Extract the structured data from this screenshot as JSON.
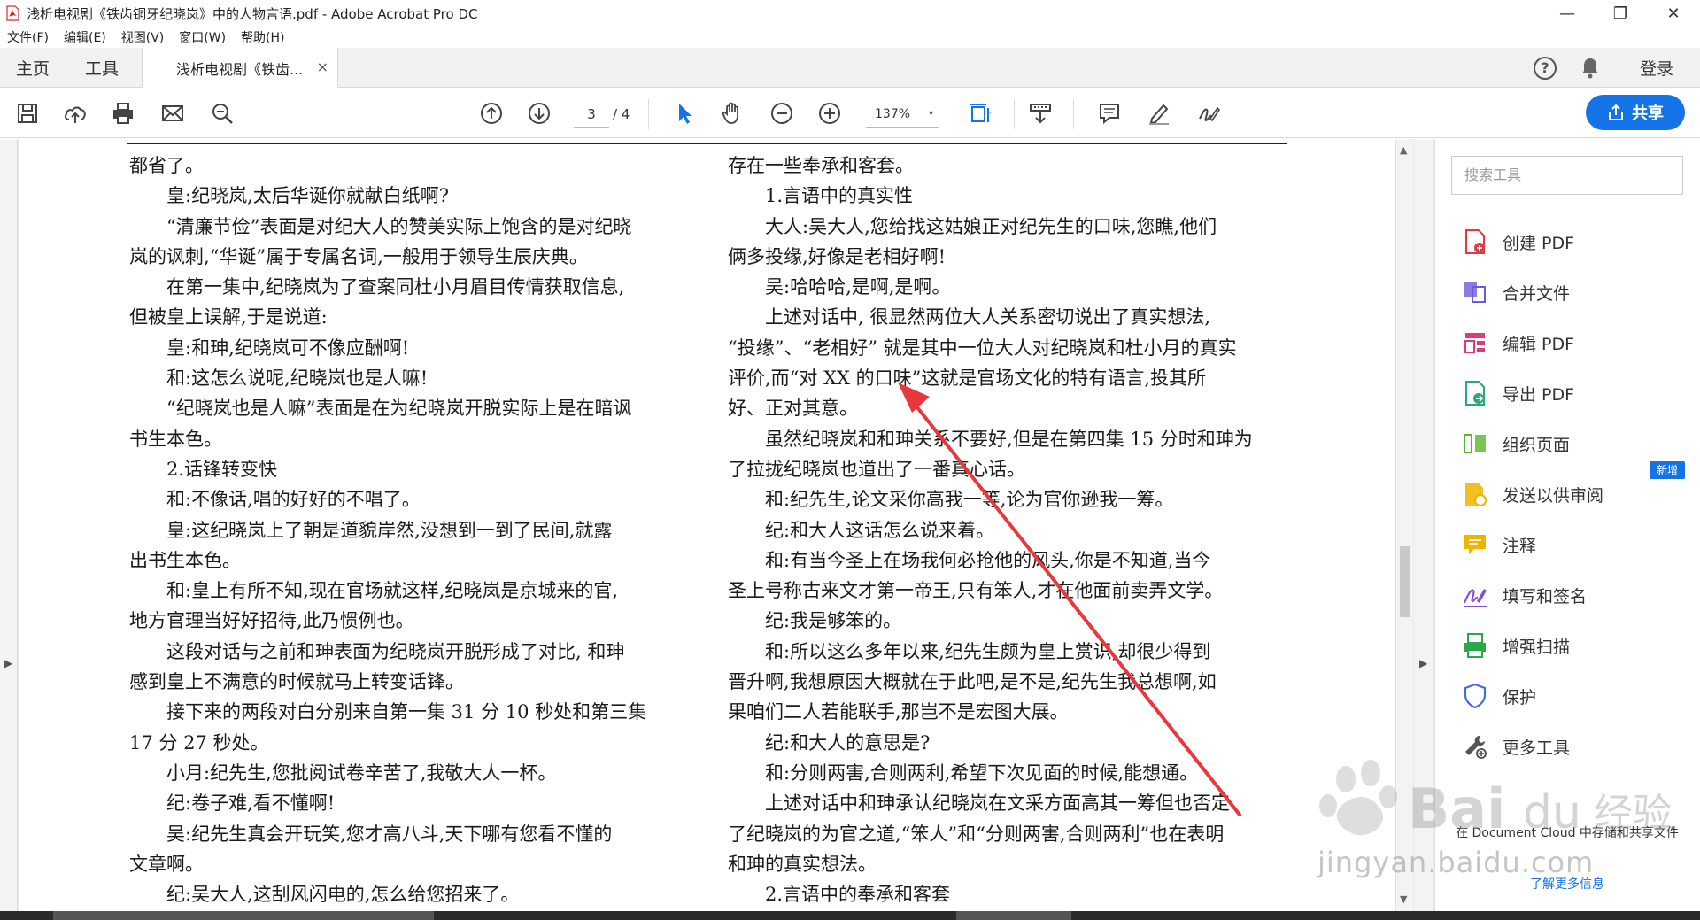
{
  "window": {
    "title": "浅析电视剧《铁齿铜牙纪晓岚》中的人物言语.pdf - Adobe Acrobat Pro DC",
    "minimize": "—",
    "maximize": "❐",
    "close": "✕"
  },
  "menu": [
    "文件(F)",
    "编辑(E)",
    "视图(V)",
    "窗口(W)",
    "帮助(H)"
  ],
  "tabs": {
    "home": "主页",
    "tools": "工具",
    "document": "浅析电视剧《铁齿...",
    "close": "×",
    "help": "?",
    "login": "登录"
  },
  "toolbar": {
    "page_current": "3",
    "page_total": "/ 4",
    "zoom": "137%",
    "zoom_caret": "▾",
    "share": "共享"
  },
  "document": {
    "left_column": [
      {
        "text": "都省了。",
        "indent": false
      },
      {
        "text": "皇:纪晓岚,太后华诞你就献白纸啊?",
        "indent": true
      },
      {
        "text": "“清廉节俭”表面是对纪大人的赞美实际上饱含的是对纪晓",
        "indent": true
      },
      {
        "text": "岚的讽刺,“华诞”属于专属名词,一般用于领导生辰庆典。",
        "indent": false
      },
      {
        "text": "在第一集中,纪晓岚为了查案同杜小月眉目传情获取信息,",
        "indent": true
      },
      {
        "text": "但被皇上误解,于是说道:",
        "indent": false
      },
      {
        "text": "皇:和珅,纪晓岚可不像应酬啊!",
        "indent": true
      },
      {
        "text": "和:这怎么说呢,纪晓岚也是人嘛!",
        "indent": true
      },
      {
        "text": "“纪晓岚也是人嘛”表面是在为纪晓岚开脱实际上是在暗讽",
        "indent": true
      },
      {
        "text": "书生本色。",
        "indent": false
      },
      {
        "text": "2.话锋转变快",
        "indent": true
      },
      {
        "text": "和:不像话,唱的好好的不唱了。",
        "indent": true
      },
      {
        "text": "皇:这纪晓岚上了朝是道貌岸然,没想到一到了民间,就露",
        "indent": true
      },
      {
        "text": "出书生本色。",
        "indent": false
      },
      {
        "text": "和:皇上有所不知,现在官场就这样,纪晓岚是京城来的官,",
        "indent": true
      },
      {
        "text": "地方官理当好好招待,此乃惯例也。",
        "indent": false
      },
      {
        "text": "这段对话与之前和珅表面为纪晓岚开脱形成了对比, 和珅",
        "indent": true
      },
      {
        "text": "感到皇上不满意的时候就马上转变话锋。",
        "indent": false
      },
      {
        "text": "接下来的两段对白分别来自第一集 31 分 10 秒处和第三集",
        "indent": true
      },
      {
        "text": "17 分 27 秒处。",
        "indent": false
      },
      {
        "text": "小月:纪先生,您批阅试卷辛苦了,我敬大人一杯。",
        "indent": true
      },
      {
        "text": "纪:卷子难,看不懂啊!",
        "indent": true
      },
      {
        "text": "吴:纪先生真会开玩笑,您才高八斗,天下哪有您看不懂的",
        "indent": true
      },
      {
        "text": "文章啊。",
        "indent": false
      },
      {
        "text": "纪:吴大人,这刮风闪电的,怎么给您招来了。",
        "indent": true
      }
    ],
    "right_column": [
      {
        "text": "存在一些奉承和客套。",
        "indent": false
      },
      {
        "text": "1.言语中的真实性",
        "indent": true
      },
      {
        "text": "大人:吴大人,您给找这姑娘正对纪先生的口味,您瞧,他们",
        "indent": true
      },
      {
        "text": "俩多投缘,好像是老相好啊!",
        "indent": false
      },
      {
        "text": "吴:哈哈哈,是啊,是啊。",
        "indent": true
      },
      {
        "text": "上述对话中, 很显然两位大人关系密切说出了真实想法,",
        "indent": true
      },
      {
        "text": "“投缘”、“老相好” 就是其中一位大人对纪晓岚和杜小月的真实",
        "indent": false
      },
      {
        "text": "评价,而“对 XX 的口味”这就是官场文化的特有语言,投其所",
        "indent": false
      },
      {
        "text": "好、正对其意。",
        "indent": false
      },
      {
        "text": "虽然纪晓岚和和珅关系不要好,但是在第四集 15 分时和珅为",
        "indent": true
      },
      {
        "text": "了拉拢纪晓岚也道出了一番真心话。",
        "indent": false
      },
      {
        "text": "和:纪先生,论文采你高我一等,论为官你逊我一筹。",
        "indent": true
      },
      {
        "text": "纪:和大人这话怎么说来着。",
        "indent": true
      },
      {
        "text": "和:有当今圣上在场我何必抢他的风头,你是不知道,当今",
        "indent": true
      },
      {
        "text": "圣上号称古来文才第一帝王,只有笨人,才在他面前卖弄文学。",
        "indent": false
      },
      {
        "text": "纪:我是够笨的。",
        "indent": true
      },
      {
        "text": "和:所以这么多年以来,纪先生颇为皇上赏识,却很少得到",
        "indent": true
      },
      {
        "text": "晋升啊,我想原因大概就在于此吧,是不是,纪先生我总想啊,如",
        "indent": false
      },
      {
        "text": "果咱们二人若能联手,那岂不是宏图大展。",
        "indent": false
      },
      {
        "text": "纪:和大人的意思是?",
        "indent": true
      },
      {
        "text": "和:分则两害,合则两利,希望下次见面的时候,能想通。",
        "indent": true
      },
      {
        "text": "上述对话中和珅承认纪晓岚在文采方面高其一筹但也否定",
        "indent": true
      },
      {
        "text": "了纪晓岚的为官之道,“笨人”和“分则两害,合则两利”也在表明",
        "indent": false
      },
      {
        "text": "和珅的真实想法。",
        "indent": false
      },
      {
        "text": "2.言语中的奉承和客套",
        "indent": true
      }
    ]
  },
  "right_panel": {
    "search_placeholder": "搜索工具",
    "tools": [
      {
        "label": "创建 PDF",
        "icon": "create-pdf-icon",
        "color": "#e03a3e"
      },
      {
        "label": "合并文件",
        "icon": "combine-files-icon",
        "color": "#6a5bd6"
      },
      {
        "label": "编辑 PDF",
        "icon": "edit-pdf-icon",
        "color": "#e03a7a"
      },
      {
        "label": "导出 PDF",
        "icon": "export-pdf-icon",
        "color": "#2aa87a"
      },
      {
        "label": "组织页面",
        "icon": "organize-pages-icon",
        "color": "#5ab52e"
      },
      {
        "label": "发送以供审阅",
        "icon": "send-for-review-icon",
        "color": "#f0b400"
      },
      {
        "label": "注释",
        "icon": "comment-icon",
        "color": "#f0b400"
      },
      {
        "label": "填写和签名",
        "icon": "fill-sign-icon",
        "color": "#8a4bd6"
      },
      {
        "label": "增强扫描",
        "icon": "enhance-scan-icon",
        "color": "#2aa84a"
      },
      {
        "label": "保护",
        "icon": "protect-icon",
        "color": "#4a6ad6"
      },
      {
        "label": "更多工具",
        "icon": "more-tools-icon",
        "color": "#555555"
      }
    ],
    "new_badge": "新增",
    "dc_text": "在 Document Cloud 中存储和共享文件",
    "dc_link": "了解更多信息"
  },
  "watermark": "jingyan.baidu.com",
  "colors": {
    "accent": "#1473e6",
    "annotation_arrow": "#e8383d"
  }
}
